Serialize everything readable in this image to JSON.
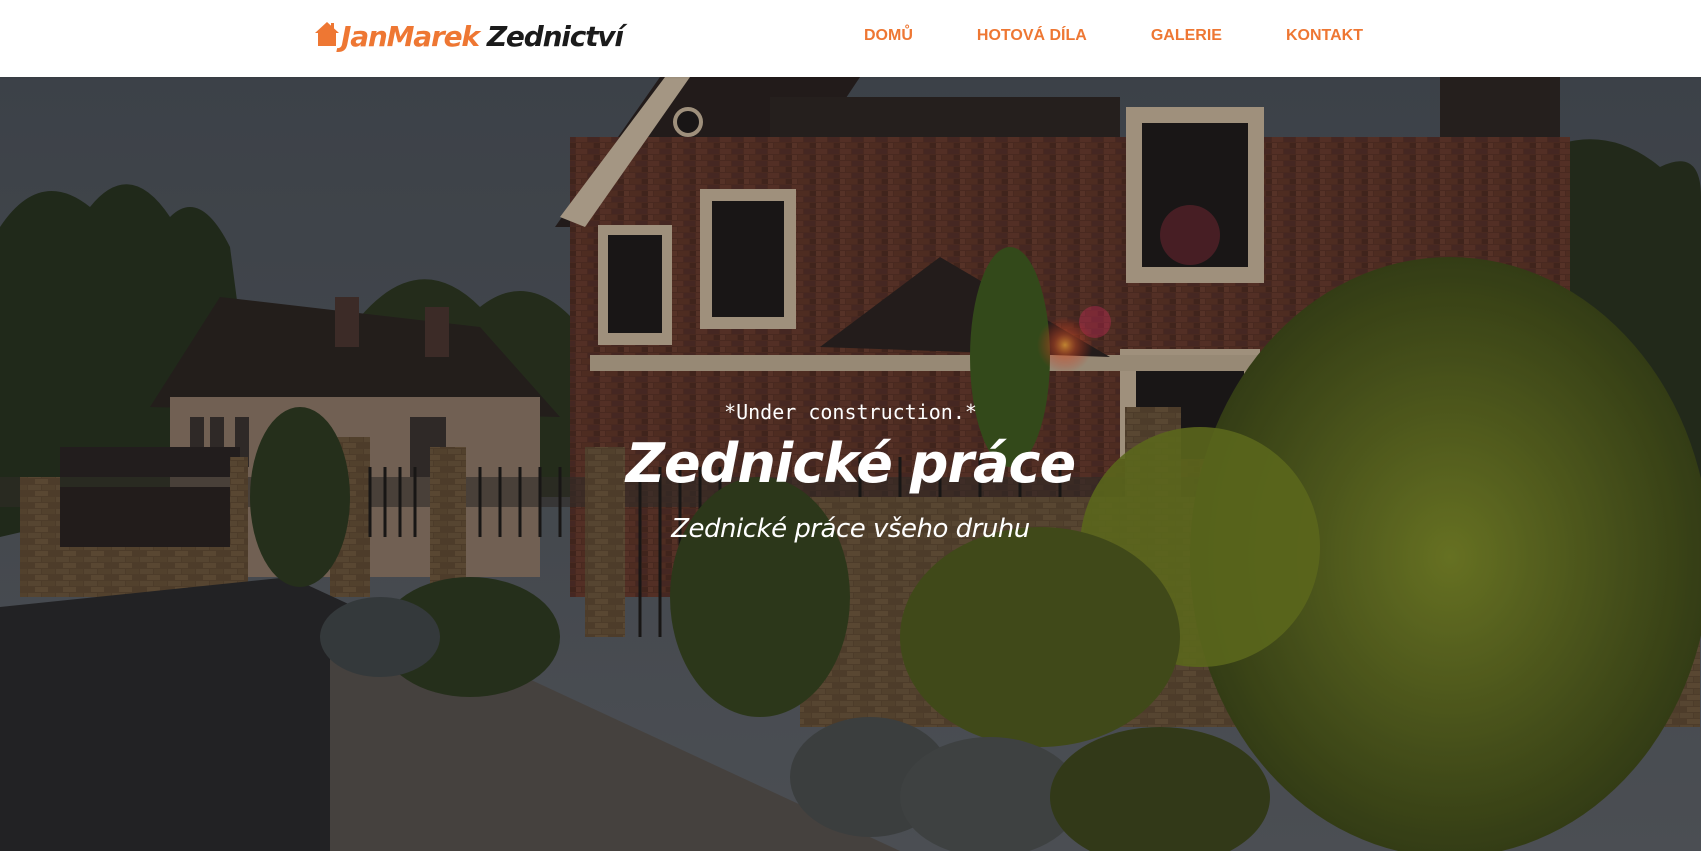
{
  "brand": {
    "name": "JanMarek",
    "suffix": "Zednictví",
    "accent_color": "#ee7733",
    "icon": "house-icon"
  },
  "nav": {
    "items": [
      {
        "label": "DOMŮ"
      },
      {
        "label": "HOTOVÁ DÍLA"
      },
      {
        "label": "GALERIE"
      },
      {
        "label": "KONTAKT"
      }
    ]
  },
  "hero": {
    "notice": "*Under construction.*",
    "title": "Zednické práce",
    "subtitle": "Zednické práce všeho druhu",
    "background": "brick-house-with-garden-photo"
  }
}
